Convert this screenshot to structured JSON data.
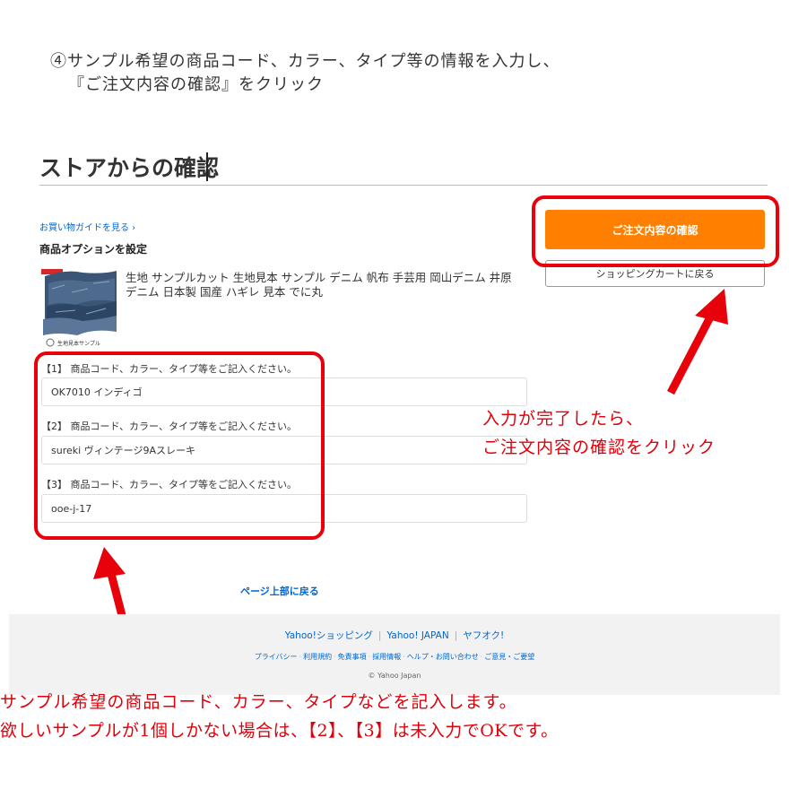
{
  "instruction": {
    "line1": "④サンプル希望の商品コード、カラー、タイプ等の情報を入力し、",
    "line2": "『ご注文内容の確認』をクリック"
  },
  "store": {
    "title": "ストアからの確認",
    "guide_link": "お買い物ガイドを見る ›",
    "options_heading": "商品オプションを設定",
    "product_name": "生地 サンプルカット 生地見本 サンプル デニム 帆布 手芸用 岡山デニム 井原デニム 日本製 国産 ハギレ 見本 でに丸",
    "thumb_caption": "生地見本サンプル"
  },
  "fields": [
    {
      "label": "【1】 商品コード、カラー、タイプ等をご記入ください。",
      "value": "OK7010 インディゴ"
    },
    {
      "label": "【2】 商品コード、カラー、タイプ等をご記入ください。",
      "value": "sureki ヴィンテージ9Aスレーキ"
    },
    {
      "label": "【3】 商品コード、カラー、タイプ等をご記入ください。",
      "value": "ooe-j-17"
    }
  ],
  "buttons": {
    "confirm": "ご注文内容の確認",
    "back_to_cart": "ショッピングカートに戻る"
  },
  "annotations": {
    "right_line1": "入力が完了したら、",
    "right_line2": "ご注文内容の確認をクリック",
    "bottom_line1": "サンプル希望の商品コード、カラー、タイプなどを記入します。",
    "bottom_line2": "欲しいサンプルが1個しかない場合は、【2】、【3】は未入力でOKです。"
  },
  "page_top_link": "ページ上部に戻る",
  "footer": {
    "links": [
      "Yahoo!ショッピング",
      "Yahoo! JAPAN",
      "ヤフオク!"
    ],
    "sub_links": [
      "プライバシー",
      "利用規約",
      "免責事項",
      "採用情報",
      "ヘルプ・お問い合わせ",
      "ご意見・ご要望"
    ],
    "copyright": "© Yahoo Japan"
  },
  "colors": {
    "accent": "#ff7f00",
    "annotation_red": "#e0000a",
    "link_blue": "#0066cc"
  }
}
